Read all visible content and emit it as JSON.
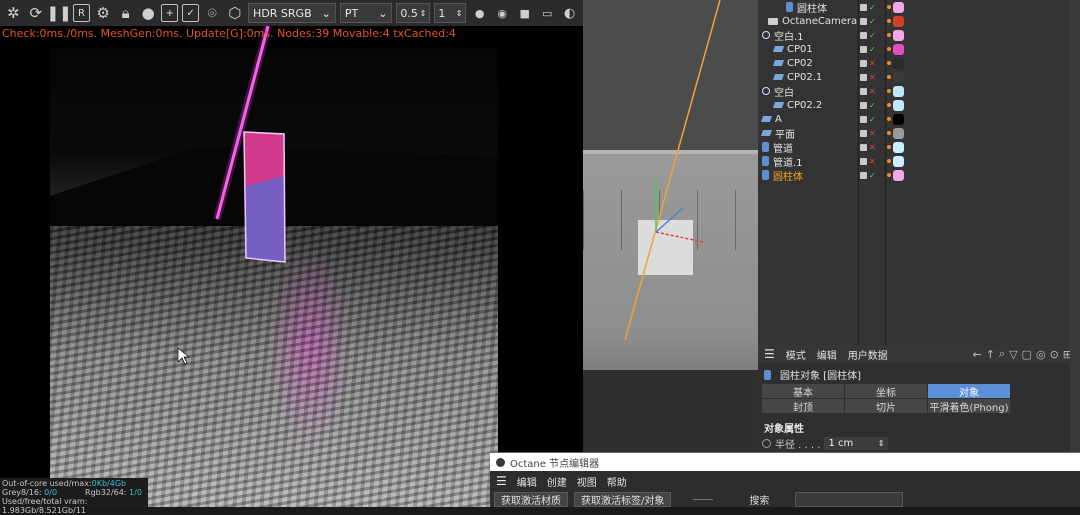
{
  "toolbar": {
    "icons": [
      "settings-icon",
      "refresh-icon",
      "pause-icon",
      "region-icon",
      "gear-icon",
      "lock-icon",
      "clay-icon",
      "focus-icon",
      "pick-icon",
      "pin-icon",
      "hdr-icon"
    ],
    "color_space": "HDR SRGB",
    "kernel": "PT",
    "value1": "0.5",
    "value2": "1"
  },
  "render": {
    "status": "Check:0ms./0ms. MeshGen:0ms. Update[G]:0ms. Nodes:39 Movable:4 txCached:4",
    "stats": {
      "line1": "Out-of-core used/max:",
      "line1_value": "0Kb/4Gb",
      "line2a": "Grey8/16: ",
      "line2a_value": "0/0",
      "line2b": "Rgb32/64: ",
      "line2b_value": "1/0",
      "line3": "Used/free/total vram: 1.983Gb/8.521Gb/11"
    }
  },
  "object_manager": {
    "rows": [
      {
        "name": "圆柱体",
        "icon": "cyl",
        "indent": 24,
        "selected": false
      },
      {
        "name": "OctaneCamera",
        "icon": "cam",
        "indent": 6,
        "selected": false
      },
      {
        "name": "空白.1",
        "icon": "null",
        "indent": 0,
        "selected": false
      },
      {
        "name": "CP01",
        "icon": "poly",
        "indent": 12,
        "selected": false
      },
      {
        "name": "CP02",
        "icon": "poly",
        "indent": 12,
        "selected": false
      },
      {
        "name": "CP02.1",
        "icon": "poly",
        "indent": 12,
        "selected": false
      },
      {
        "name": "空白",
        "icon": "null",
        "indent": 0,
        "selected": false
      },
      {
        "name": "CP02.2",
        "icon": "poly",
        "indent": 12,
        "selected": false
      },
      {
        "name": "A",
        "icon": "poly",
        "indent": 0,
        "selected": false
      },
      {
        "name": "平面",
        "icon": "poly",
        "indent": 0,
        "selected": false
      },
      {
        "name": "管道",
        "icon": "cyl",
        "indent": 0,
        "selected": false
      },
      {
        "name": "管道.1",
        "icon": "cyl",
        "indent": 0,
        "selected": false
      },
      {
        "name": "圆柱体",
        "icon": "cyl",
        "indent": 0,
        "selected": true
      }
    ],
    "material_colors": [
      "#f4a6e8",
      "#d0402a",
      "#f4a6e8",
      "#e04fbd",
      "#2a2a2a",
      "#3a3a3a",
      "#bfe8ff",
      "#bfe8ff",
      "#000000",
      "#9a9a9a",
      "#c8f0ff",
      "#c8f0ff",
      "#f4a6e8"
    ]
  },
  "attribute_manager": {
    "menu": [
      "模式",
      "编辑",
      "用户数据"
    ],
    "title": "圆柱对象 [圆柱体]",
    "tabs": [
      {
        "label": "基本",
        "active": false
      },
      {
        "label": "坐标",
        "active": false
      },
      {
        "label": "对象",
        "active": true
      },
      {
        "label": "封顶",
        "active": false
      },
      {
        "label": "切片",
        "active": false
      },
      {
        "label": "平滑着色(Phong)",
        "active": false
      }
    ],
    "section": "对象属性",
    "radius_label": "半径 . . . .",
    "radius_value": "1 cm"
  },
  "node_editor": {
    "title": "Octane 节点编辑器",
    "menu": [
      "编辑",
      "创建",
      "视图",
      "帮助"
    ],
    "button1": "获取激活材质",
    "button2": "获取激活标签/对象",
    "search_label": "搜索"
  },
  "colors": {
    "status_text": "#e0542a",
    "accent_blue": "#5b8fd8",
    "selected_orange": "#f5a623"
  }
}
